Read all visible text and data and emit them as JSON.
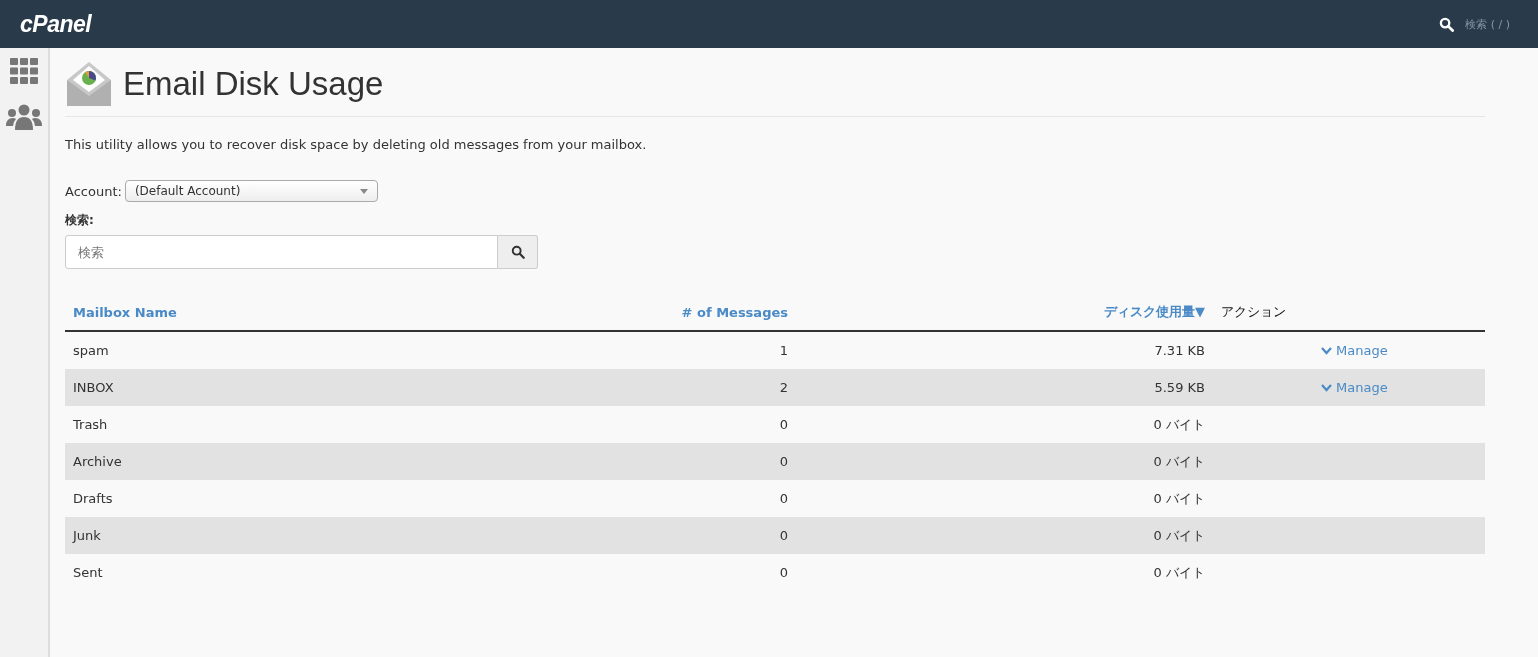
{
  "header": {
    "logo": "cPanel",
    "search_placeholder": "検索 ( / )"
  },
  "page": {
    "title": "Email Disk Usage",
    "description": "This utility allows you to recover disk space by deleting old messages from your mailbox."
  },
  "account": {
    "label": "Account:",
    "value": "(Default Account)"
  },
  "search": {
    "label": "検索:",
    "placeholder": "検索"
  },
  "table": {
    "columns": [
      {
        "label": "Mailbox Name",
        "sortable": true
      },
      {
        "label": "# of Messages",
        "sortable": true
      },
      {
        "label": "ディスク使用量",
        "sortable": true,
        "sort_indicator": "▼"
      },
      {
        "label": "アクション",
        "sortable": false
      }
    ],
    "rows": [
      {
        "name": "spam",
        "messages": "1",
        "size": "7.31 KB",
        "action": "Manage"
      },
      {
        "name": "INBOX",
        "messages": "2",
        "size": "5.59 KB",
        "action": "Manage"
      },
      {
        "name": "Trash",
        "messages": "0",
        "size": "0 バイト"
      },
      {
        "name": "Archive",
        "messages": "0",
        "size": "0 バイト"
      },
      {
        "name": "Drafts",
        "messages": "0",
        "size": "0 バイト"
      },
      {
        "name": "Junk",
        "messages": "0",
        "size": "0 バイト"
      },
      {
        "name": "Sent",
        "messages": "0",
        "size": "0 バイト"
      }
    ]
  }
}
